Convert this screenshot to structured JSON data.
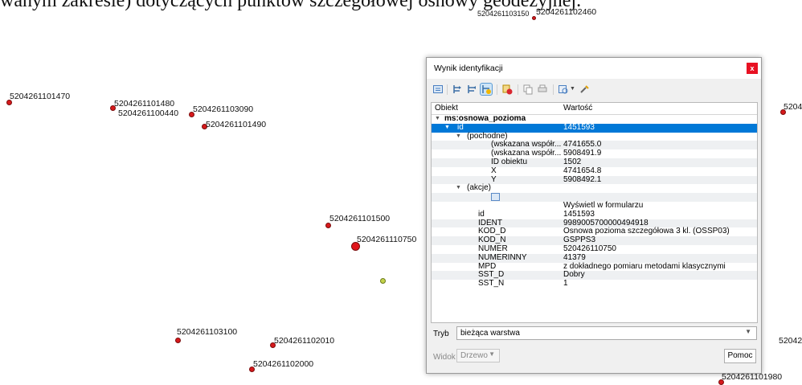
{
  "document": {
    "heading_fragment": "wanym zakresie) dotyczących punktów szczegółowej osnowy geodezyjnej."
  },
  "map": {
    "labels": [
      "5204261103150",
      "5204261102460",
      "5204261101470",
      "5204261101480",
      "5204261100440",
      "5204261103090",
      "5204261101490",
      "5204261101500",
      "5204261110750",
      "5204261103100",
      "5204261102010",
      "5204261102000",
      "5204261101980",
      "5204",
      "52042"
    ],
    "colors": {
      "point": "#d7191c",
      "highlight_point": "#c3d24a"
    }
  },
  "dialog": {
    "title": "Wynik identyfikacji",
    "close_glyph": "x",
    "columns": {
      "feature": "Obiekt",
      "value": "Wartość"
    },
    "layer": "ms:osnowa_pozioma",
    "id_row": {
      "key": "id",
      "value": "1451593"
    },
    "derived_group": "(pochodne)",
    "derived": [
      {
        "key": "(wskazana współr...",
        "value": "4741655.0"
      },
      {
        "key": "(wskazana współr...",
        "value": "5908491.9"
      },
      {
        "key": "ID obiektu",
        "value": "1502"
      },
      {
        "key": "X",
        "value": "4741654.8"
      },
      {
        "key": "Y",
        "value": "5908492.1"
      }
    ],
    "actions_group": "(akcje)",
    "action_form": "Wyświetl w formularzu",
    "attributes": [
      {
        "key": "id",
        "value": "1451593"
      },
      {
        "key": "IDENT",
        "value": "9989005700000494918"
      },
      {
        "key": "KOD_D",
        "value": "Osnowa pozioma szczegółowa 3 kl. (OSSP03)"
      },
      {
        "key": "KOD_N",
        "value": "GSPPS3"
      },
      {
        "key": "NUMER",
        "value": "520426110750"
      },
      {
        "key": "NUMERINNY",
        "value": "41379"
      },
      {
        "key": "MPD",
        "value": "z dokładnego pomiaru metodami klasycznymi"
      },
      {
        "key": "SST_D",
        "value": "Dobry"
      },
      {
        "key": "SST_N",
        "value": "1"
      }
    ],
    "mode_label": "Tryb",
    "mode_value": "bieżąca warstwa",
    "view_label": "Widok",
    "view_value": "Drzewo",
    "help_button": "Pomoc",
    "colors": {
      "selection": "#0078d7",
      "close": "#e81123"
    }
  }
}
